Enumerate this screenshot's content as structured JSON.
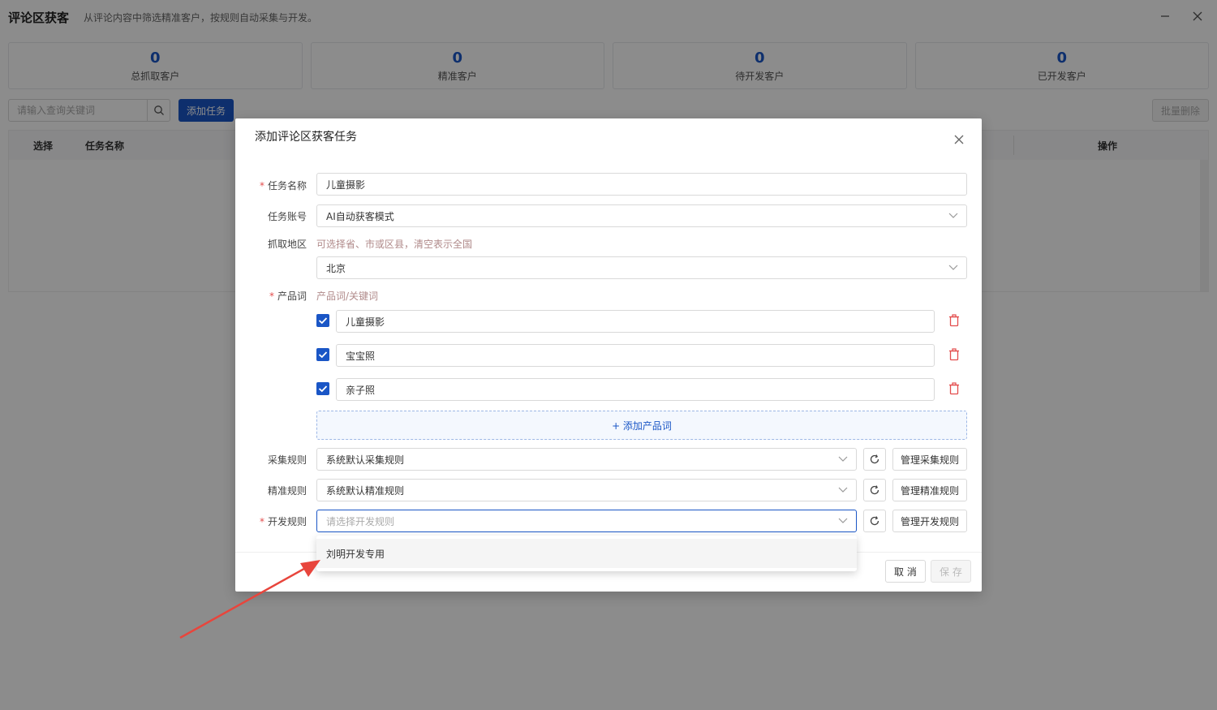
{
  "app": {
    "title": "评论区获客",
    "description": "从评论内容中筛选精准客户，按规则自动采集与开发。"
  },
  "stats": [
    {
      "value": "0",
      "label": "总抓取客户"
    },
    {
      "value": "0",
      "label": "精准客户"
    },
    {
      "value": "0",
      "label": "待开发客户"
    },
    {
      "value": "0",
      "label": "已开发客户"
    }
  ],
  "toolbar": {
    "search_placeholder": "请输入查询关键词",
    "add_task_label": "添加任务",
    "batch_delete_label": "批量删除"
  },
  "table": {
    "headers": [
      "选择",
      "任务名称",
      "操作"
    ]
  },
  "dialog": {
    "title": "添加评论区获客任务",
    "task_name": {
      "label": "任务名称",
      "value": "儿童摄影"
    },
    "task_account": {
      "label": "任务账号",
      "value": "AI自动获客模式"
    },
    "region": {
      "label": "抓取地区",
      "hint": "可选择省、市或区县，清空表示全国",
      "value": "北京"
    },
    "product_words": {
      "label": "产品词",
      "hint": "产品词/关键词",
      "items": [
        {
          "value": "儿童摄影",
          "checked": true
        },
        {
          "value": "宝宝照",
          "checked": true
        },
        {
          "value": "亲子照",
          "checked": true
        }
      ],
      "add_label": "+ 添加产品词"
    },
    "collect_rule": {
      "label": "采集规则",
      "value": "系统默认采集规则",
      "manage_label": "管理采集规则"
    },
    "precise_rule": {
      "label": "精准规则",
      "value": "系统默认精准规则",
      "manage_label": "管理精准规则"
    },
    "develop_rule": {
      "label": "开发规则",
      "placeholder": "请选择开发规则",
      "manage_label": "管理开发规则"
    },
    "dropdown_options": [
      "刘明开发专用"
    ],
    "cancel_label": "取 消",
    "save_label": "保 存"
  },
  "colors": {
    "primary": "#1a56c6",
    "required": "#e34d4d",
    "delete": "#e34d4d",
    "annotation_arrow": "#e8453c"
  }
}
